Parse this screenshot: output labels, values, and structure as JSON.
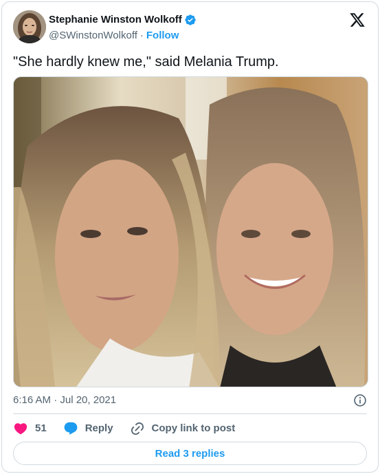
{
  "author": {
    "display_name": "Stephanie Winston Wolkoff",
    "handle": "@SWinstonWolkoff",
    "separator": "·",
    "follow_label": "Follow"
  },
  "tweet": {
    "text": "\"She hardly knew me,\" said Melania Trump.",
    "timestamp": "6:16 AM · Jul 20, 2021"
  },
  "actions": {
    "like_count": "51",
    "reply_label": "Reply",
    "copy_link_label": "Copy link to post"
  },
  "read_replies_label": "Read 3 replies",
  "colors": {
    "accent": "#1d9bf0",
    "like": "#f91880",
    "text": "#0f1419",
    "secondary": "#536471",
    "border": "#cfd9de"
  },
  "icons": {
    "verified": "verified-badge-icon",
    "platform": "x-logo-icon",
    "info": "info-icon",
    "like": "heart-icon",
    "reply": "speech-bubble-icon",
    "copy_link": "link-icon"
  }
}
